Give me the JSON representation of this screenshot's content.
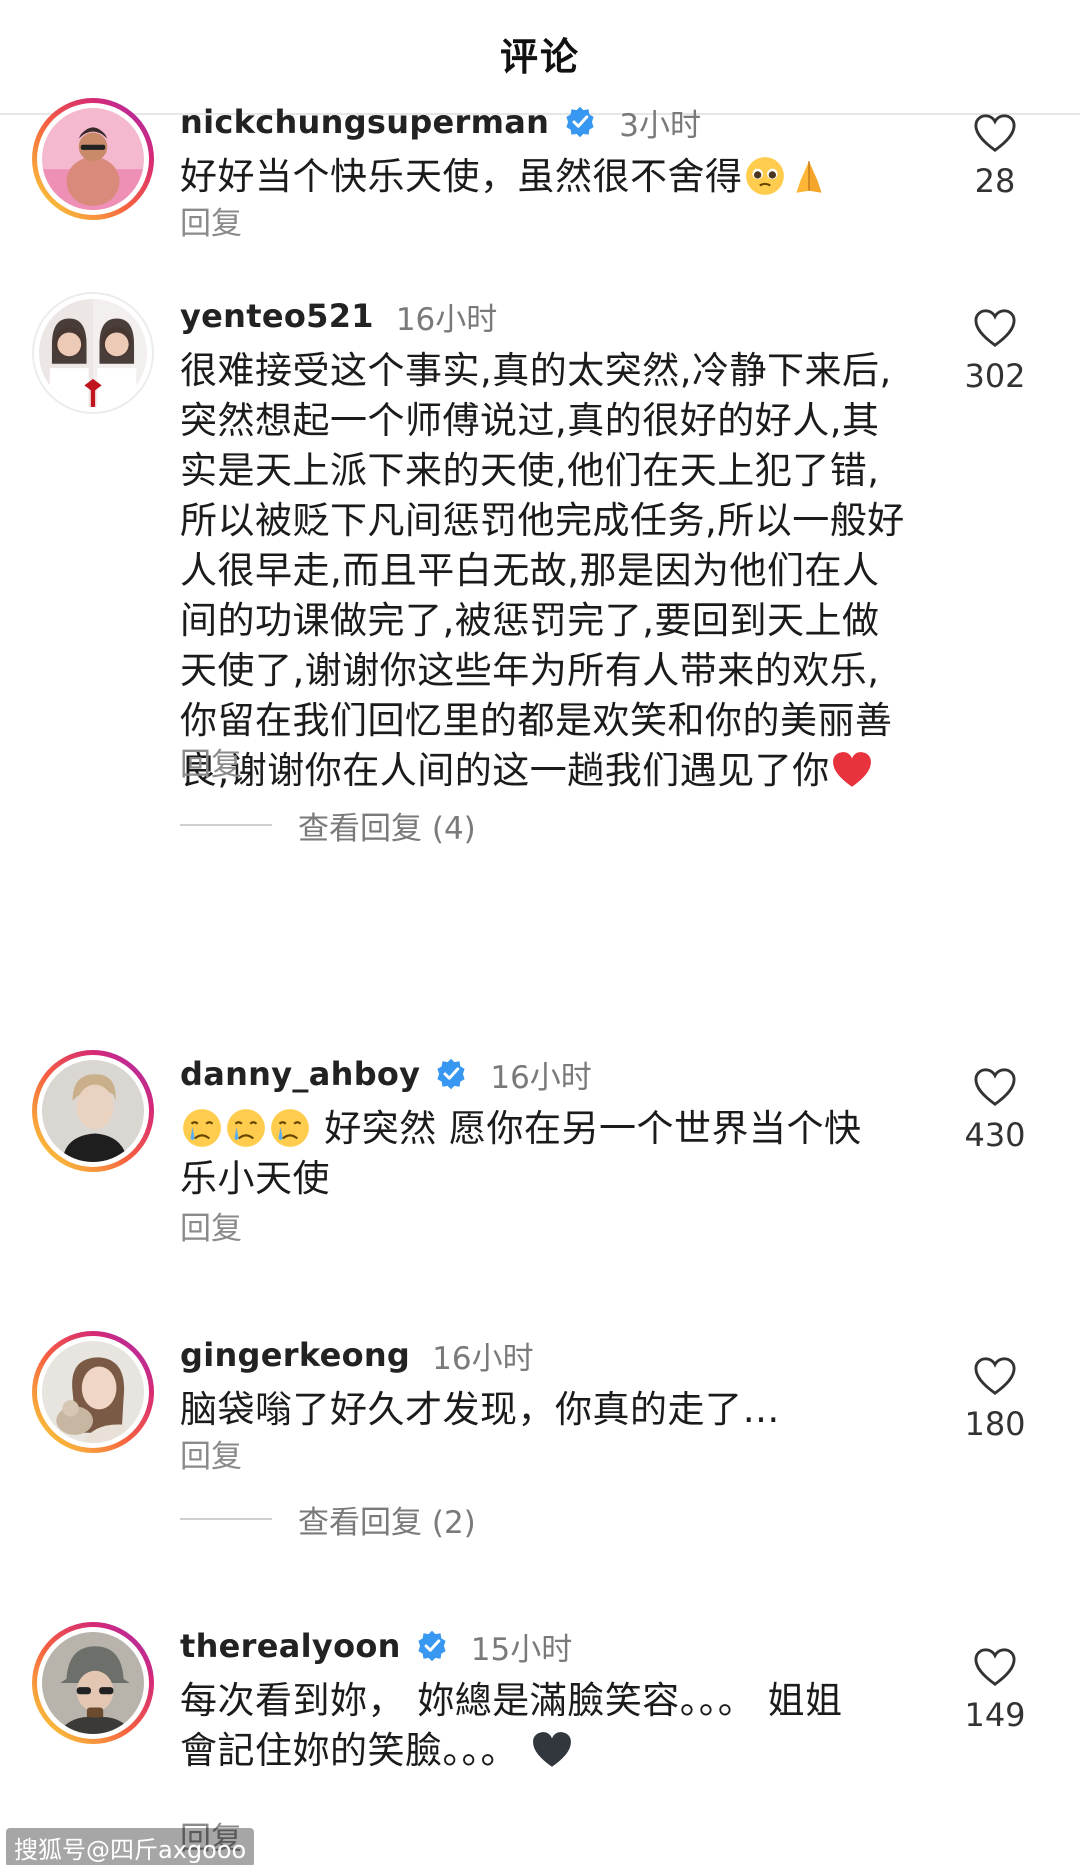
{
  "header": {
    "title": "评论"
  },
  "reply_label": "回复",
  "comments": [
    {
      "username": "nickchungsuperman",
      "verified": true,
      "time": "3小时",
      "text_lines": [
        "好好当个快乐天使，虽然很不舍得"
      ],
      "emojis": [
        "pleading-face-emoji",
        "folded-hands-emoji"
      ],
      "likes": "28"
    },
    {
      "username": "yenteo521",
      "verified": false,
      "time": "16小时",
      "text_lines": [
        "很难接受这个事实,真的太突然,冷静下来后,",
        "突然想起一个师傅说过,真的很好的好人,其",
        "实是天上派下来的天使,他们在天上犯了错,",
        "所以被贬下凡间惩罚他完成任务,所以一般好",
        "人很早走,而且平白无故,那是因为他们在人",
        "间的功课做完了,被惩罚完了,要回到天上做",
        "天使了,谢谢你这些年为所有人带来的欢乐,",
        "你留在我们回忆里的都是欢笑和你的美丽善",
        "良,谢谢你在人间的这一趟我们遇见了你"
      ],
      "emojis": [
        "red-heart-emoji"
      ],
      "likes": "302",
      "view_replies": "查看回复 (4)"
    },
    {
      "username": "danny_ahboy",
      "verified": true,
      "time": "16小时",
      "text_lines": [
        "好突然 愿你在另一个世界当个快",
        "乐小天使"
      ],
      "emojis": [
        "crying-face-emoji",
        "crying-face-emoji",
        "crying-face-emoji"
      ],
      "likes": "430"
    },
    {
      "username": "gingerkeong",
      "verified": false,
      "time": "16小时",
      "text_lines": [
        "脑袋嗡了好久才发现，你真的走了…"
      ],
      "emojis": [],
      "likes": "180",
      "view_replies": "查看回复 (2)"
    },
    {
      "username": "therealyoon",
      "verified": true,
      "time": "15小时",
      "text_lines": [
        "每次看到妳， 妳總是滿臉笑容。。。 姐姐",
        "會記住妳的笑臉。。。"
      ],
      "emojis": [
        "black-heart-emoji"
      ],
      "likes": "149"
    }
  ],
  "watermark": "搜狐号@四斤axgooo",
  "colors": {
    "verified_blue": "#3897f0",
    "story_ring_start": "#f9c43a",
    "story_ring_end": "#962fbf",
    "heart_red": "#e8323c",
    "muted_text": "#7a7a7a"
  }
}
